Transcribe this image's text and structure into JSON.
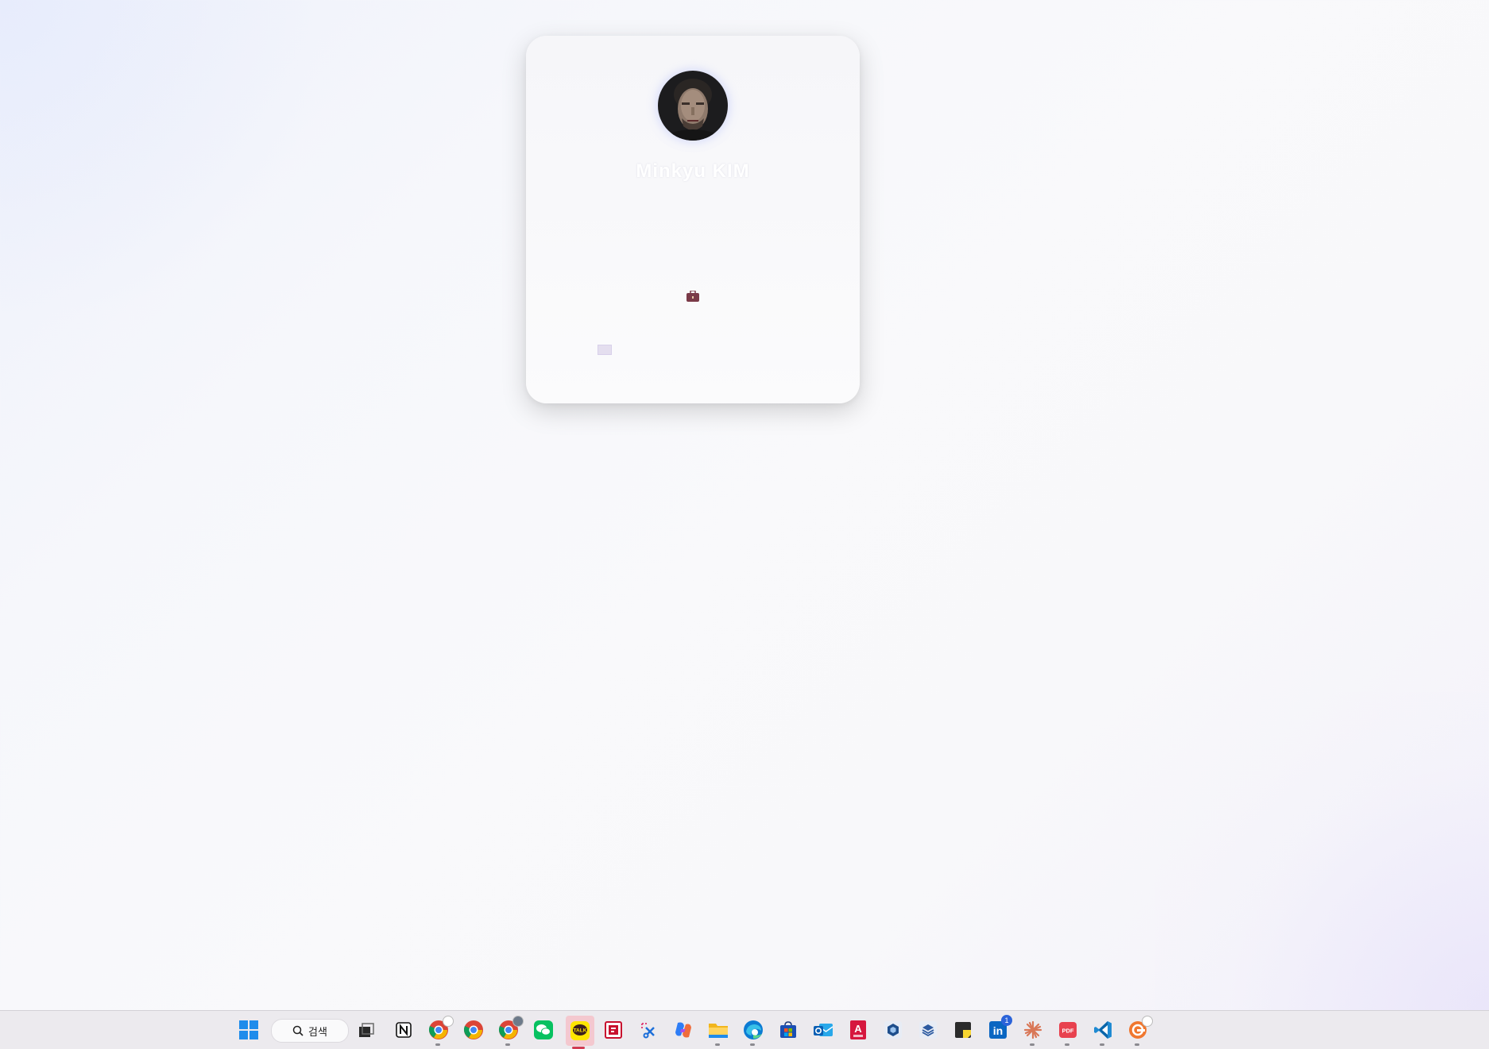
{
  "profile": {
    "name": "Minkyu KIM",
    "avatar": "portrait-photo"
  },
  "taskbar": {
    "search_label": "검색",
    "kakaotalk_label": "TALK",
    "acrobat_label": "PDF",
    "linkedin_label": "in",
    "linkedin_badge": "1",
    "autocad_label": "A",
    "icons": [
      "windows-start-icon",
      "search-icon",
      "task-view-icon",
      "notion-icon",
      "chrome-icon",
      "chrome-icon",
      "chrome-icon",
      "wechat-icon",
      "kakaotalk-icon",
      "remote-app-icon",
      "snipping-tool-icon",
      "copilot-icon",
      "file-explorer-icon",
      "edge-icon",
      "microsoft-store-icon",
      "outlook-icon",
      "autocad-icon",
      "sketchup-icon",
      "layers-app-icon",
      "sticky-notes-icon",
      "linkedin-icon",
      "claude-icon",
      "pdf-icon",
      "vscode-icon",
      "app-icon"
    ]
  }
}
